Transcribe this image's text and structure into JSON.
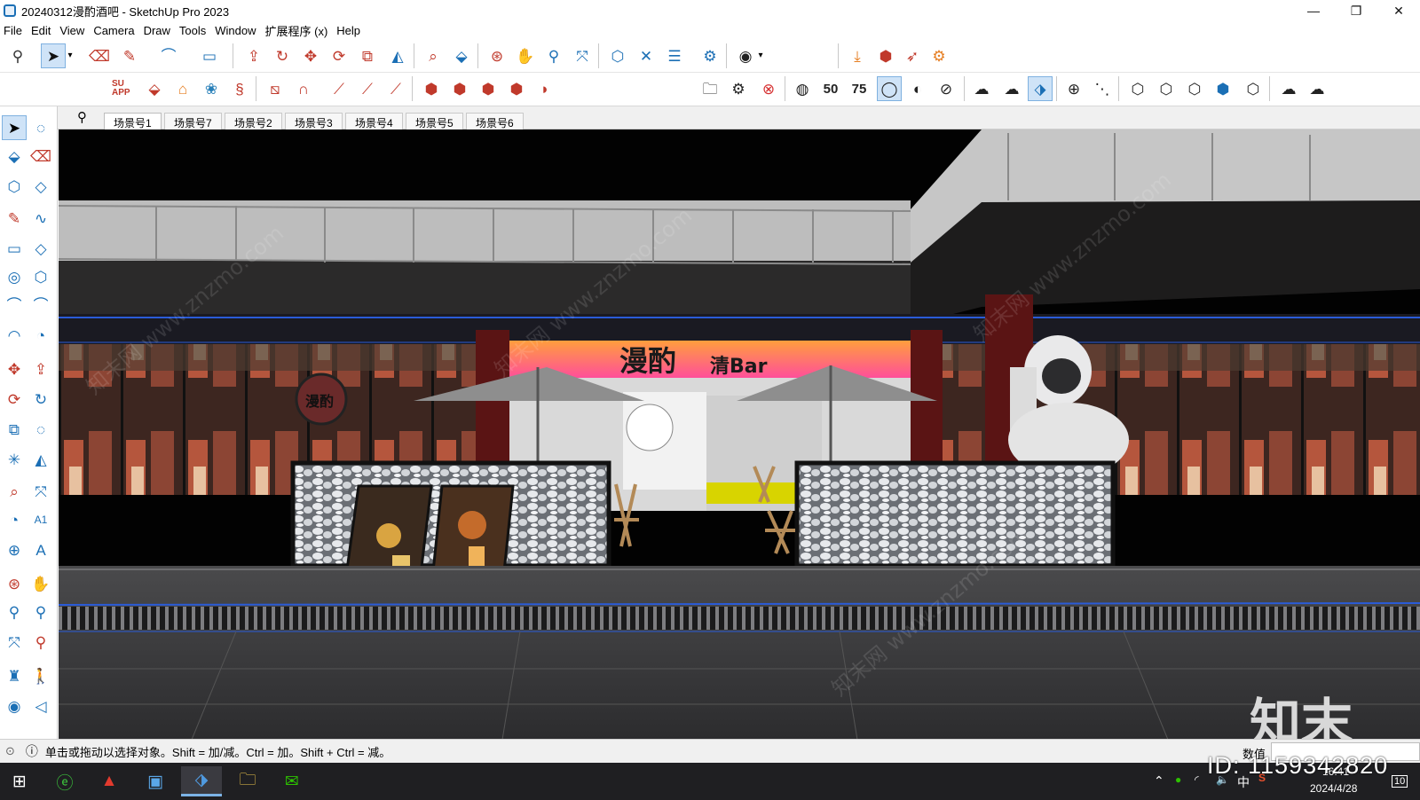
{
  "window": {
    "title": "20240312漫酌酒吧 - SketchUp Pro 2023",
    "minimize": "—",
    "restore": "❐",
    "close": "✕"
  },
  "menu": [
    "File",
    "Edit",
    "View",
    "Camera",
    "Draw",
    "Tools",
    "Window",
    "扩展程序 (x)",
    "Help"
  ],
  "scenes": [
    "场景号1",
    "场景号7",
    "场景号2",
    "场景号3",
    "场景号4",
    "场景号5",
    "场景号6"
  ],
  "toolbar2": {
    "su_app": "SU APP",
    "badge_50": "50",
    "badge_75": "75"
  },
  "sign": {
    "brand": "漫酌",
    "suffix": "清Bar",
    "round_logo": "漫酌"
  },
  "status": {
    "hint": "单击或拖动以选择对象。Shift = 加/减。Ctrl = 加。Shift + Ctrl = 减。",
    "value_label": "数值",
    "value": ""
  },
  "taskbar": {
    "time": "16:41",
    "date": "2024/4/28",
    "ime": "中",
    "notifications": "10"
  },
  "watermark": {
    "logo": "知末",
    "id": "ID: 1159342820",
    "diagonal": "知末网 www.znzmo.com"
  },
  "colors": {
    "accent": "#1b6fb5",
    "selection": "#cfe3f7",
    "sign_gradient_top": "#ff9e3d",
    "sign_gradient_bottom": "#ff4f9a"
  }
}
